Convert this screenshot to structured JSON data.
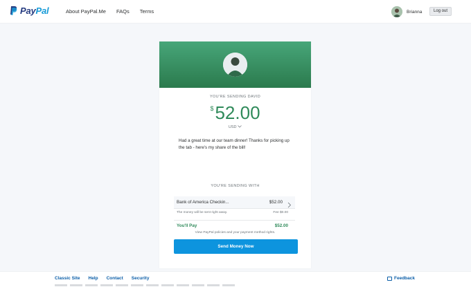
{
  "header": {
    "logo_part1": "Pay",
    "logo_part2": "Pal",
    "nav": [
      "About PayPal.Me",
      "FAQs",
      "Terms"
    ],
    "user_name": "Brianna",
    "logout_label": "Log out"
  },
  "payment": {
    "recipient_heading": "YOU'RE SENDING DAVID",
    "currency_symbol": "$",
    "amount": "52.00",
    "currency": "USD",
    "note": "Had a great time at our team dinner! Thanks for picking up the tab - here's my share of the bill!",
    "funding_heading": "YOU'RE SENDING WITH",
    "funding_source": "Bank of America Checkin...",
    "funding_amount": "$52.00",
    "sent_notice": "The money will be sent right away.",
    "fee_text": "Fee $0.00",
    "you_pay_label": "You'll Pay",
    "you_pay_amount": "$52.00",
    "policies_text": "View PayPal policies and your payment method rights.",
    "send_button": "Send Money Now"
  },
  "footer": {
    "links": [
      "Classic Site",
      "Help",
      "Contact",
      "Security"
    ],
    "feedback_label": "Feedback"
  },
  "colors": {
    "brand_dark": "#253b80",
    "brand_light": "#179bd7",
    "hero_green": "#47a679",
    "amount_green": "#2f8a5a",
    "button_blue": "#0d94de"
  }
}
